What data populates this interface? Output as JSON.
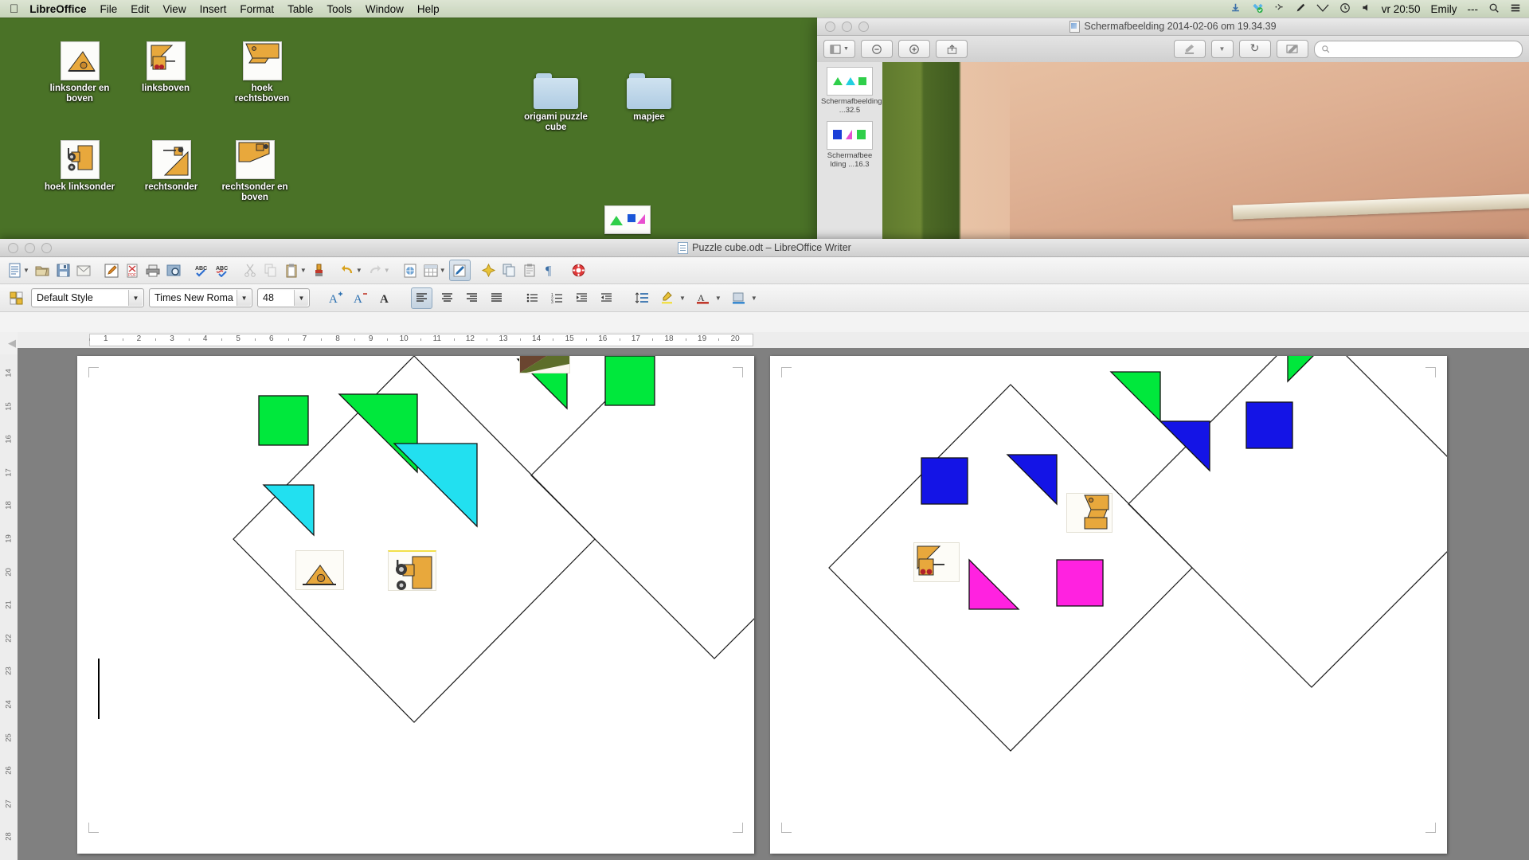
{
  "menubar": {
    "apple_icon": "apple-icon",
    "app_name": "LibreOffice",
    "items": [
      "File",
      "Edit",
      "View",
      "Insert",
      "Format",
      "Table",
      "Tools",
      "Window",
      "Help"
    ],
    "status_icons": [
      "download-icon",
      "dropbox-icon",
      "bluetooth-icon",
      "dictation-pen-icon",
      "wifi-icon",
      "time-machine-icon",
      "volume-icon"
    ],
    "clock": "vr 20:50",
    "user": "Emily",
    "user_extra": "---",
    "search_icon": "search-icon",
    "notification_icon": "notification-center-icon"
  },
  "desktop": {
    "icons": [
      {
        "name": "linksonder en boven",
        "type": "image-file"
      },
      {
        "name": "linksboven",
        "type": "image-file"
      },
      {
        "name": "hoek rechtsboven",
        "type": "image-file"
      },
      {
        "name": "hoek linksonder",
        "type": "image-file"
      },
      {
        "name": "rechtsonder",
        "type": "image-file"
      },
      {
        "name": "rechtsonder en boven",
        "type": "image-file"
      }
    ],
    "folders": [
      {
        "name": "origami puzzle cube"
      },
      {
        "name": "mapjee"
      }
    ]
  },
  "preview_window": {
    "title": "Schermafbeelding 2014-02-06 om 19.34.39",
    "traffic_lights": [
      "close-button",
      "minimize-button",
      "zoom-button"
    ],
    "toolbar": {
      "sidebar_toggle": "sidebar-view-icon",
      "zoom_out": "zoom-out-icon",
      "zoom_in": "zoom-in-icon",
      "share": "share-icon",
      "highlight": "highlight-pen-icon",
      "rotate": "rotate-icon",
      "markup": "markup-toolbox-icon",
      "search_placeholder": ""
    },
    "sidebar_items": [
      {
        "label": "Schermafbeelding ...32.5"
      },
      {
        "label": "Schermafbee lding ...16.3"
      }
    ]
  },
  "libreoffice": {
    "title": "Puzzle cube.odt – LibreOffice Writer",
    "standard_toolbar": [
      "new-document-icon",
      "new-dropdown-caret",
      "open-icon",
      "save-icon",
      "email-icon",
      "edit-mode-icon",
      "export-pdf-icon",
      "print-icon",
      "print-preview-icon",
      "spelling-icon",
      "autospellcheck-icon",
      "cut-icon",
      "copy-icon",
      "paste-icon",
      "paste-dropdown-caret",
      "clone-formatting-icon",
      "undo-icon",
      "undo-dropdown-caret",
      "redo-icon",
      "redo-dropdown-caret",
      "hyperlink-icon",
      "table-icon",
      "table-dropdown-caret",
      "draw-functions-icon",
      "gallery-icon",
      "navigator-icon",
      "formatting-marks-icon",
      "help-icon"
    ],
    "formatting_toolbar": {
      "paragraph_style_icon": "paragraph-style-icon",
      "paragraph_style": "Default Style",
      "font_name": "Times New Roma",
      "font_size": "48",
      "buttons": [
        "increase-font-icon",
        "decrease-font-icon",
        "bold-icon",
        "align-left-icon",
        "align-center-icon",
        "align-right-icon",
        "align-justify-icon",
        "unordered-list-icon",
        "ordered-list-icon",
        "decrease-indent-icon",
        "increase-indent-icon",
        "line-spacing-icon",
        "highlighting-color-icon",
        "font-color-icon",
        "background-color-icon"
      ]
    },
    "navigation_bar": {
      "previous": "previous-icon",
      "next": "next-icon"
    },
    "ruler": {
      "horizontal_labels": [
        "1",
        "2",
        "3",
        "4",
        "5",
        "6",
        "7",
        "8",
        "9",
        "10",
        "11",
        "12",
        "13",
        "14",
        "15",
        "16",
        "17",
        "18",
        "19",
        "20"
      ],
      "vertical_labels": [
        "14",
        "15",
        "16",
        "17",
        "18",
        "19",
        "20",
        "21",
        "22",
        "23",
        "24",
        "25",
        "26",
        "27",
        "28"
      ]
    },
    "document": {
      "pages": [
        {
          "page_index": 1,
          "shapes": [
            {
              "kind": "square",
              "color": "#00e83c",
              "name": "green-square-left"
            },
            {
              "kind": "triangle",
              "color": "#00e83c",
              "name": "green-triangle-mid"
            },
            {
              "kind": "triangle",
              "color": "#22e0f0",
              "name": "cyan-triangle-mid"
            },
            {
              "kind": "triangle",
              "color": "#22e0f0",
              "name": "cyan-triangle-lower"
            },
            {
              "kind": "triangle",
              "color": "#00e83c",
              "name": "green-triangle-top"
            },
            {
              "kind": "square",
              "color": "#00e83c",
              "name": "green-square-top"
            }
          ],
          "images": [
            {
              "name": "photo-thumb-wallpaper"
            },
            {
              "name": "photo-thumb-triangle-robot"
            },
            {
              "name": "photo-thumb-machine"
            }
          ]
        },
        {
          "page_index": 2,
          "shapes": [
            {
              "kind": "triangle",
              "color": "#00e83c",
              "name": "green-triangle-top-left"
            },
            {
              "kind": "triangle",
              "color": "#00e83c",
              "name": "green-triangle-top-right"
            },
            {
              "kind": "triangle",
              "color": "#1414e6",
              "name": "blue-triangle-upper"
            },
            {
              "kind": "square",
              "color": "#1414e6",
              "name": "blue-square-right"
            },
            {
              "kind": "square",
              "color": "#1414e6",
              "name": "blue-square-left"
            },
            {
              "kind": "triangle",
              "color": "#1414e6",
              "name": "blue-triangle-mid"
            },
            {
              "kind": "triangle",
              "color": "#ff22e0",
              "name": "magenta-triangle"
            },
            {
              "kind": "square",
              "color": "#ff22e0",
              "name": "magenta-square"
            }
          ],
          "images": [
            {
              "name": "photo-thumb-robot-right"
            },
            {
              "name": "photo-thumb-robot-left"
            }
          ]
        }
      ]
    },
    "colors": {
      "green": "#00e83c",
      "cyan": "#22e0f0",
      "blue": "#1414e6",
      "magenta": "#ff22e0",
      "outline": "#111111"
    }
  }
}
